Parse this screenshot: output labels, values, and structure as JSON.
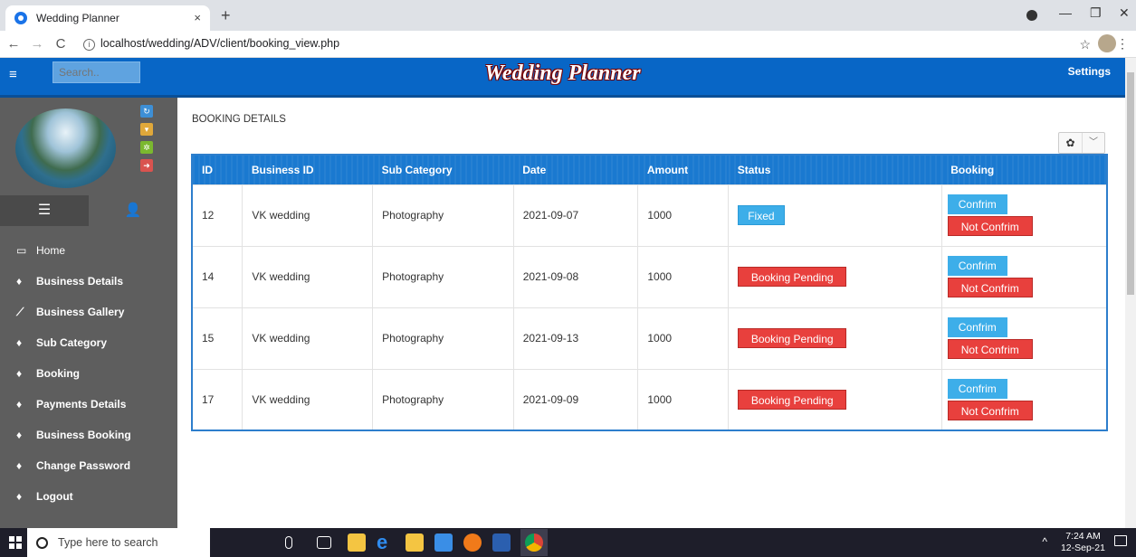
{
  "browser": {
    "tab_title": "Wedding Planner",
    "tab_close": "×",
    "new_tab": "+",
    "url": "localhost/wedding/ADV/client/booking_view.php",
    "win_min": "—",
    "win_max": "❐",
    "win_close": "✕"
  },
  "header": {
    "menu_icon": "≡",
    "search_placeholder": "Search..",
    "brand": "Wedding Planner",
    "settings": "Settings"
  },
  "sidebar": {
    "items": [
      {
        "label": "Home",
        "icon": "monitor-icon"
      },
      {
        "label": "Business Details",
        "icon": "fire-icon"
      },
      {
        "label": "Business Gallery",
        "icon": "brush-icon"
      },
      {
        "label": "Sub Category",
        "icon": "fire-icon"
      },
      {
        "label": "Booking",
        "icon": "fire-icon"
      },
      {
        "label": " Payments Details",
        "icon": "fire-icon"
      },
      {
        "label": "Business Booking",
        "icon": "fire-icon"
      },
      {
        "label": "Change Password",
        "icon": "fire-icon"
      },
      {
        "label": "Logout",
        "icon": "fire-icon"
      }
    ]
  },
  "main": {
    "title": "BOOKING DETAILS",
    "columns": [
      "ID",
      "Business ID",
      "Sub Category",
      "Date",
      "Amount",
      "Status",
      "Booking"
    ],
    "rows": [
      {
        "id": "12",
        "business_id": "VK wedding",
        "sub_category": "Photography",
        "date": "2021-09-07",
        "amount": "1000",
        "status": "Fixed",
        "confirm": "Confrim",
        "not_confirm": "Not Confrim"
      },
      {
        "id": "14",
        "business_id": "VK wedding",
        "sub_category": "Photography",
        "date": "2021-09-08",
        "amount": "1000",
        "status": "Booking Pending",
        "confirm": "Confrim",
        "not_confirm": "Not Confrim"
      },
      {
        "id": "15",
        "business_id": "VK wedding",
        "sub_category": "Photography",
        "date": "2021-09-13",
        "amount": "1000",
        "status": "Booking Pending",
        "confirm": "Confrim",
        "not_confirm": "Not Confrim"
      },
      {
        "id": "17",
        "business_id": "VK wedding",
        "sub_category": "Photography",
        "date": "2021-09-09",
        "amount": "1000",
        "status": "Booking Pending",
        "confirm": "Confrim",
        "not_confirm": "Not Confrim"
      }
    ]
  },
  "taskbar": {
    "search_placeholder": "Type here to search",
    "time": "7:24 AM",
    "date": "12-Sep-21"
  },
  "colors": {
    "header_blue": "#0866c6",
    "table_header": "#1a79d0",
    "sidebar": "#5e5e5e",
    "status_fixed": "#3daee9",
    "status_pending": "#e8403d"
  }
}
